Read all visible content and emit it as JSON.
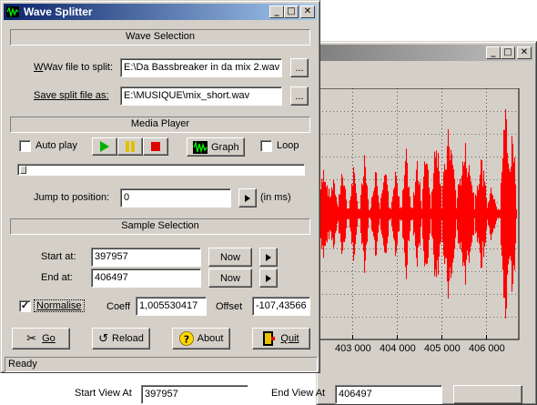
{
  "graph_window": {
    "x_ticks": [
      "403 000",
      "404 000",
      "405 000",
      "406 000"
    ],
    "bottom_labels": [
      "Start View At",
      "End View At"
    ],
    "bottom_values": [
      "397957",
      "406497"
    ],
    "waveform_color": "#ff0000",
    "icons": [
      "minimize-icon",
      "maximize-icon",
      "close-icon"
    ]
  },
  "main_window": {
    "title": "Wave Splitter",
    "wave_selection": {
      "header": "Wave Selection",
      "wav_file_label": "Wav file to split:",
      "wav_file_value": "E:\\Da Bassbreaker in da mix 2.wav",
      "save_label": "Save split file as:",
      "save_value": "E:\\MUSIQUE\\mix_short.wav",
      "browse_label": "..."
    },
    "media_player": {
      "header": "Media Player",
      "auto_play_label": "Auto play",
      "auto_play_checked": false,
      "graph_label": "Graph",
      "loop_label": "Loop",
      "loop_checked": false,
      "position_fraction": 0,
      "jump_label": "Jump to position:",
      "jump_value": "0",
      "jump_unit": "(in ms)"
    },
    "sample_selection": {
      "header": "Sample Selection",
      "start_label": "Start at:",
      "start_value": "397957",
      "end_label": "End at:",
      "end_value": "406497",
      "now_label": "Now",
      "normalise_label": "Normalise",
      "normalise_checked": true,
      "coeff_label": "Coeff",
      "coeff_value": "1,005530417",
      "offset_label": "Offset",
      "offset_value": "-107,43566"
    },
    "buttons": {
      "go": "Go",
      "reload": "Reload",
      "about": "About",
      "quit": "Quit"
    },
    "status": "Ready"
  }
}
